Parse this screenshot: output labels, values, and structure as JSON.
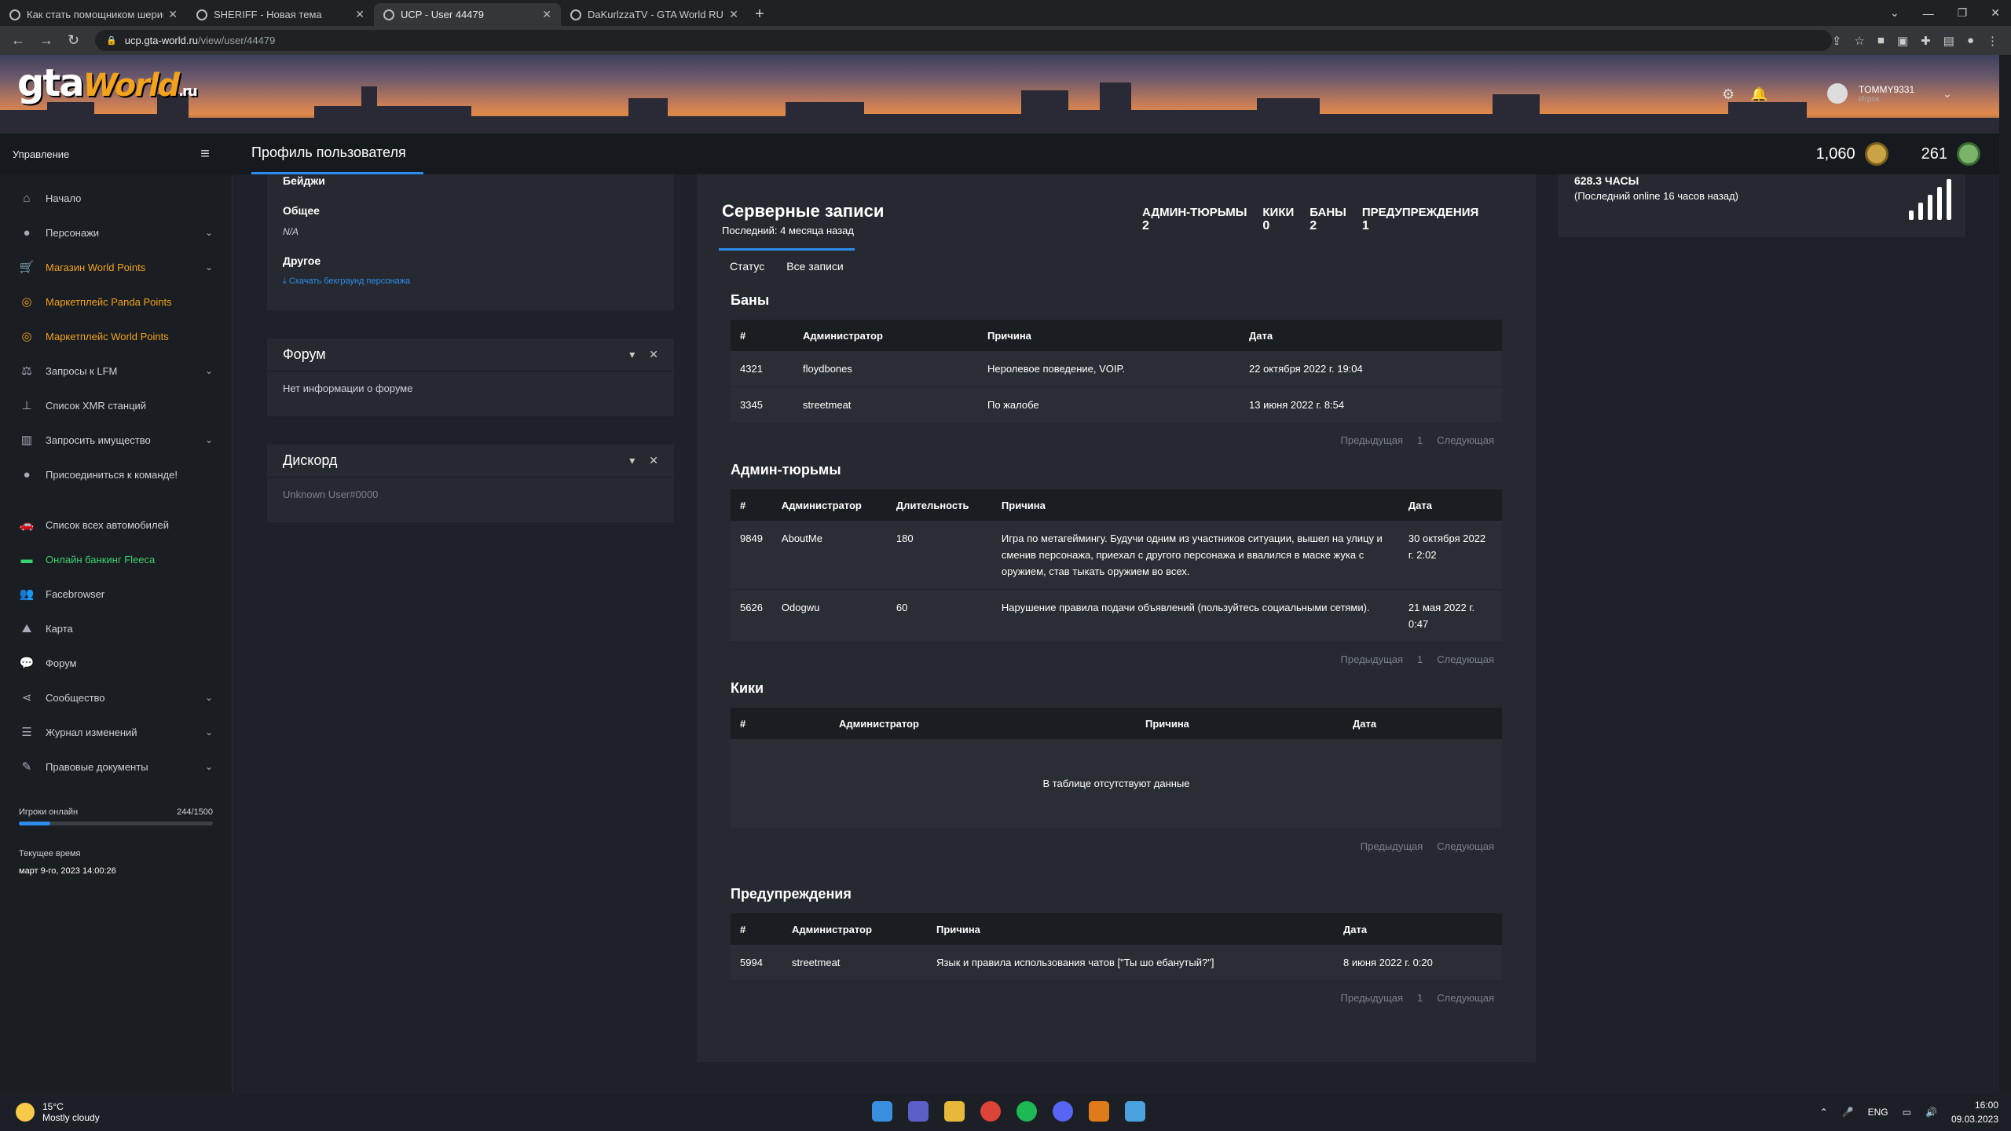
{
  "browser": {
    "tabs": [
      {
        "title": "Как стать помощником шериф"
      },
      {
        "title": "SHERIFF - Новая тема"
      },
      {
        "title": "UCP - User 44479"
      },
      {
        "title": "DaKurlzzaTV - GTA World RU"
      }
    ],
    "url_host": "ucp.gta-world.ru",
    "url_path": "/view/user/44479"
  },
  "header": {
    "logo_gta": "gta",
    "logo_world": "World",
    "logo_ru": ".ru",
    "username": "TOMMY9331",
    "role": "Игрок"
  },
  "subbar": {
    "section": "Управление",
    "page_title": "Профиль пользователя",
    "points_1": "1,060",
    "points_2": "261"
  },
  "sidebar": {
    "items": [
      {
        "label": "Начало",
        "icon": "home-icon"
      },
      {
        "label": "Персонажи",
        "icon": "user-icon"
      },
      {
        "label": "Магазин World Points",
        "icon": "cart-icon"
      },
      {
        "label": "Маркетплейс Panda Points",
        "icon": "coins-icon"
      },
      {
        "label": "Маркетплейс World Points",
        "icon": "coins-icon"
      },
      {
        "label": "Запросы к LFM",
        "icon": "scale-icon"
      },
      {
        "label": "Список XMR станций",
        "icon": "antenna-icon"
      },
      {
        "label": "Запросить имущество",
        "icon": "building-icon"
      },
      {
        "label": "Присоединиться к команде!",
        "icon": "user-plus-icon"
      },
      {
        "label": "Список всех автомобилей",
        "icon": "car-icon"
      },
      {
        "label": "Онлайн банкинг Fleeca",
        "icon": "bank-card-icon"
      },
      {
        "label": "Facebrowser",
        "icon": "users-icon"
      },
      {
        "label": "Карта",
        "icon": "map-icon"
      },
      {
        "label": "Форум",
        "icon": "comments-icon"
      },
      {
        "label": "Сообщество",
        "icon": "share-icon"
      },
      {
        "label": "Журнал изменений",
        "icon": "list-icon"
      },
      {
        "label": "Правовые документы",
        "icon": "document-icon"
      }
    ],
    "online_label": "Игроки онлайн",
    "online_value": "244/1500",
    "online_fraction": 0.163,
    "time_label": "Текущее время",
    "time_value": "март 9-го, 2023 14:00:26"
  },
  "profile": {
    "badges_label": "Бейджи",
    "general_label": "Общее",
    "general_value": "N/A",
    "other_label": "Другое",
    "download_link": "Скачать бекграунд персонажа"
  },
  "forum": {
    "title": "Форум",
    "text": "Нет информации о форуме"
  },
  "discord": {
    "title": "Дискорд",
    "text": "Unknown User#0000"
  },
  "records": {
    "title": "Серверные записи",
    "subtitle": "Последний: 4 месяца назад",
    "stats": [
      {
        "key": "АДМИН-ТЮРЬМЫ",
        "value": "2"
      },
      {
        "key": "КИКИ",
        "value": "0"
      },
      {
        "key": "БАНЫ",
        "value": "2"
      },
      {
        "key": "ПРЕДУПРЕЖДЕНИЯ",
        "value": "1"
      }
    ],
    "tab_status": "Статус",
    "tab_all": "Все записи",
    "prev": "Предыдущая",
    "next": "Следующая",
    "page": "1",
    "empty": "В таблице отсутствуют данные",
    "bans": {
      "title": "Баны",
      "headers": [
        "#",
        "Администратор",
        "Причина",
        "Дата"
      ],
      "rows": [
        [
          "4321",
          "floydbones",
          "Неролевое поведение, VOIP.",
          "22 октября 2022 г. 19:04"
        ],
        [
          "3345",
          "streetmeat",
          "По жалобе",
          "13 июня 2022 г. 8:54"
        ]
      ]
    },
    "jails": {
      "title": "Админ-тюрьмы",
      "headers": [
        "#",
        "Администратор",
        "Длительность",
        "Причина",
        "Дата"
      ],
      "rows": [
        [
          "9849",
          "AboutMe",
          "180",
          "Игра по метагеймингу. Будучи одним из участников ситуации, вышел на улицу и сменив персонажа, приехал с другого персонажа и ввалился в маске жука с оружием, став тыкать оружием во всех.",
          "30 октября 2022 г. 2:02"
        ],
        [
          "5626",
          "Odogwu",
          "60",
          "Нарушение правила подачи объявлений (пользуйтесь социальными сетями).",
          "21 мая 2022 г. 0:47"
        ]
      ]
    },
    "kicks": {
      "title": "Кики",
      "headers": [
        "#",
        "Администратор",
        "Причина",
        "Дата"
      ]
    },
    "warnings": {
      "title": "Предупреждения",
      "headers": [
        "#",
        "Администратор",
        "Причина",
        "Дата"
      ],
      "rows": [
        [
          "5994",
          "streetmeat",
          "Язык и правила использования чатов [\"Ты шо ебанутый?\"]",
          "8 июня 2022 г. 0:20"
        ]
      ]
    }
  },
  "playtime": {
    "hours": "628.3 ЧАСЫ",
    "last_online": "(Последний online 16 часов назад)"
  },
  "taskbar": {
    "temp": "15°C",
    "weather": "Mostly cloudy",
    "lang": "ENG",
    "time": "16:00",
    "date": "09.03.2023"
  }
}
